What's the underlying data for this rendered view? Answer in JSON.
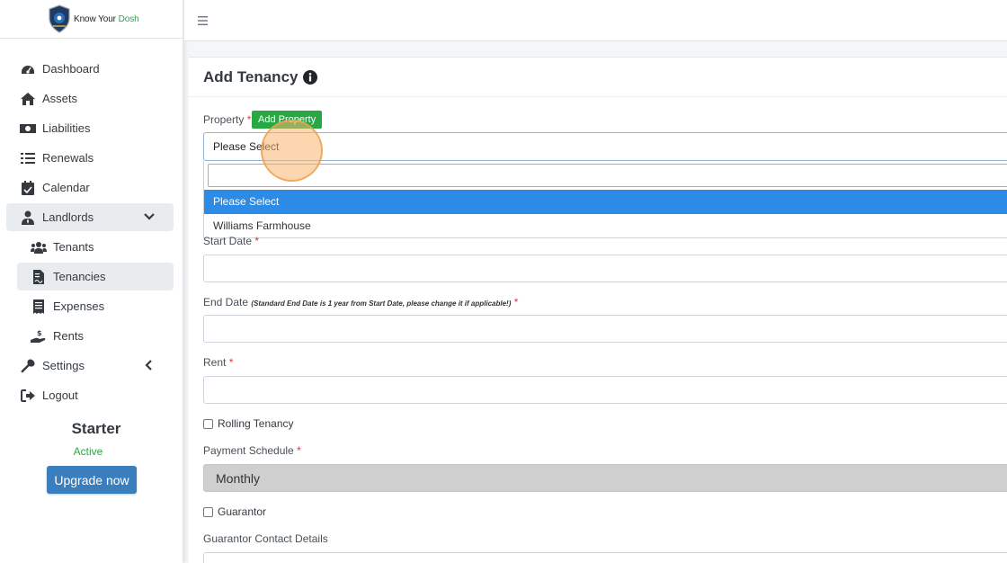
{
  "brand": {
    "name_part1": "Know Your ",
    "name_part2": "Dosh"
  },
  "sidebar": {
    "items": [
      {
        "label": "Dashboard",
        "icon": "tachometer-icon"
      },
      {
        "label": "Assets",
        "icon": "home-icon"
      },
      {
        "label": "Liabilities",
        "icon": "money-bill-icon"
      },
      {
        "label": "Renewals",
        "icon": "list-icon"
      },
      {
        "label": "Calendar",
        "icon": "calendar-check-icon"
      },
      {
        "label": "Landlords",
        "icon": "user-tie-icon",
        "expanded": true
      }
    ],
    "sub_items": [
      {
        "label": "Tenants",
        "icon": "users-icon"
      },
      {
        "label": "Tenancies",
        "icon": "file-contract-icon",
        "active": true
      },
      {
        "label": "Expenses",
        "icon": "receipt-icon"
      },
      {
        "label": "Rents",
        "icon": "hand-holding-usd-icon"
      }
    ],
    "bottom_items": [
      {
        "label": "Settings",
        "icon": "wrench-icon"
      },
      {
        "label": "Logout",
        "icon": "sign-out-icon"
      }
    ],
    "plan": {
      "name": "Starter",
      "status": "Active",
      "upgrade_label": "Upgrade now"
    }
  },
  "page": {
    "title": "Add Tenancy"
  },
  "form": {
    "property_label": "Property",
    "add_property_label": "Add Property",
    "property_value": "Please Select",
    "dropdown_options": [
      "Please Select",
      "Williams Farmhouse"
    ],
    "start_date_label": "Start Date",
    "end_date_label": "End Date",
    "end_date_hint": "(Standard End Date is 1 year from Start Date, please change it if applicable!)",
    "rent_label": "Rent",
    "rolling_label": "Rolling Tenancy",
    "payment_schedule_label": "Payment Schedule",
    "payment_schedule_value": "Monthly",
    "guarantor_label": "Guarantor",
    "guarantor_contact_label": "Guarantor Contact Details",
    "required_mark": "*"
  },
  "colors": {
    "primary": "#3a7ebe",
    "success": "#28a745",
    "danger": "#dc3545",
    "highlight": "#2b8be6"
  }
}
